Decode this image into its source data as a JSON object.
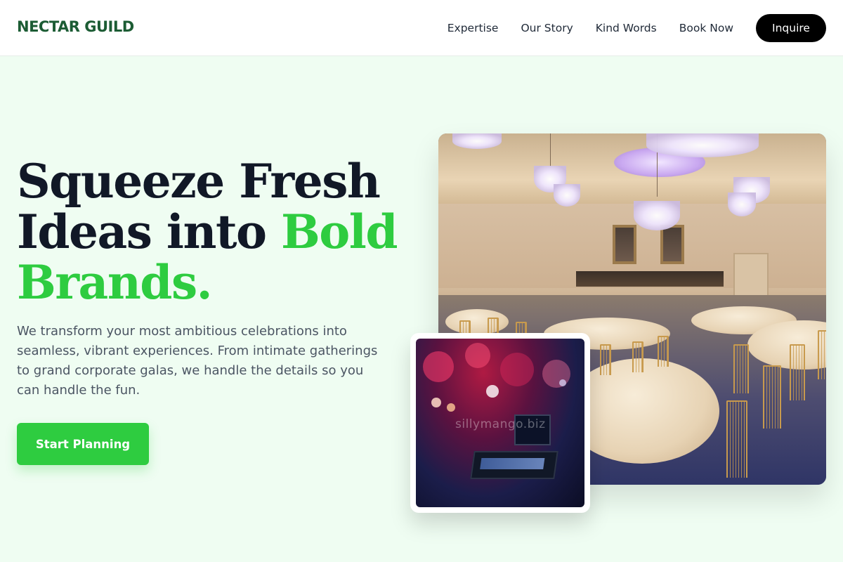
{
  "brand": {
    "name": "NECTAR GUILD"
  },
  "nav": {
    "items": [
      {
        "label": "Expertise"
      },
      {
        "label": "Our Story"
      },
      {
        "label": "Kind Words"
      },
      {
        "label": "Book Now"
      }
    ],
    "cta_label": "Inquire"
  },
  "hero": {
    "headline_line1": "Squeeze Fresh",
    "headline_line2_plain": "Ideas into ",
    "headline_line2_accent": "Bold",
    "headline_line3_accent": "Brands.",
    "lead": "We transform your most ambitious celebrations into seamless, vibrant experiences. From intimate gatherings to grand corporate galas, we handle the details so you can handle the fun.",
    "cta_label": "Start Planning",
    "overlay_watermark": "sillymango.biz"
  },
  "colors": {
    "brand": "#1c5c34",
    "accent": "#2ecc40",
    "background": "#effdf2",
    "text_dark": "#111827",
    "text_muted": "#4b5563",
    "inquire_bg": "#000000"
  }
}
